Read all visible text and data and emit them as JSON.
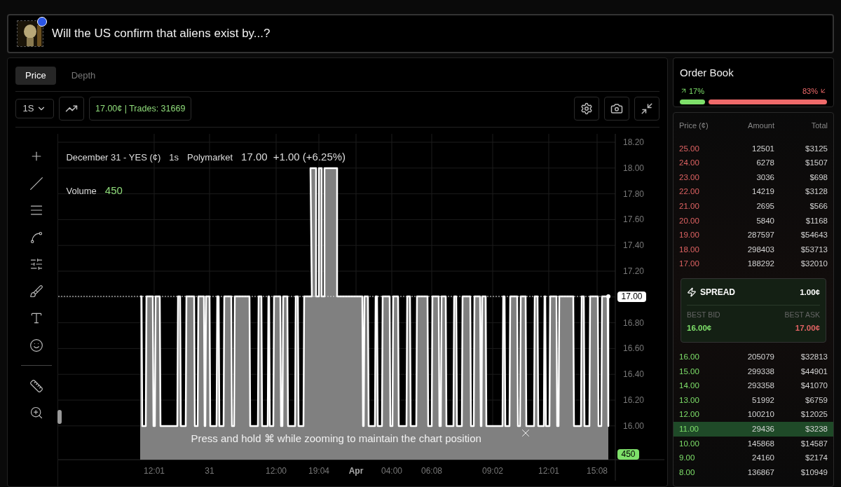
{
  "market": {
    "title": "Will the US confirm that aliens exist by...?"
  },
  "chart_panel": {
    "tabs": [
      {
        "label": "Price",
        "selected": true
      },
      {
        "label": "Depth",
        "selected": false
      }
    ],
    "interval": "1S",
    "ticker": "17.00¢ | Trades: 31669",
    "legend": {
      "series": "December 31 - YES (¢)",
      "interval": "1s",
      "source": "Polymarket",
      "price": "17.00",
      "change": "+1.00 (+6.25%)",
      "volume_label": "Volume",
      "volume": "450"
    },
    "y_ticks": [
      "18.20",
      "18.00",
      "17.80",
      "17.60",
      "17.40",
      "17.20",
      "16.80",
      "16.60",
      "16.40",
      "16.20",
      "16.00"
    ],
    "x_ticks": [
      {
        "label": "12:01",
        "bold": false
      },
      {
        "label": "31",
        "bold": false
      },
      {
        "label": "12:00",
        "bold": false
      },
      {
        "label": "19:04",
        "bold": false
      },
      {
        "label": "Apr",
        "bold": true
      },
      {
        "label": "04:00",
        "bold": false
      },
      {
        "label": "06:08",
        "bold": false
      },
      {
        "label": "09:02",
        "bold": false
      },
      {
        "label": "12:01",
        "bold": false
      },
      {
        "label": "15:08",
        "bold": false
      }
    ],
    "price_badge": "17.00",
    "volume_badge": "450",
    "hint": "Press and hold ⌘ while zooming to maintain the chart position"
  },
  "order_book": {
    "title": "Order Book",
    "buy_share": "17%",
    "sell_share": "83%",
    "level": 0.17,
    "columns": [
      "Price (¢)",
      "Amount",
      "Total"
    ],
    "asks": [
      {
        "price": "25.00",
        "amount": "12501",
        "total": "$3125",
        "selected": false
      },
      {
        "price": "24.00",
        "amount": "6278",
        "total": "$1507",
        "selected": false
      },
      {
        "price": "23.00",
        "amount": "3036",
        "total": "$698",
        "selected": false
      },
      {
        "price": "22.00",
        "amount": "14219",
        "total": "$3128",
        "selected": false
      },
      {
        "price": "21.00",
        "amount": "2695",
        "total": "$566",
        "selected": false
      },
      {
        "price": "20.00",
        "amount": "5840",
        "total": "$1168",
        "selected": false
      },
      {
        "price": "19.00",
        "amount": "287597",
        "total": "$54643",
        "selected": false
      },
      {
        "price": "18.00",
        "amount": "298403",
        "total": "$53713",
        "selected": false
      },
      {
        "price": "17.00",
        "amount": "188292",
        "total": "$32010",
        "selected": false
      }
    ],
    "spread": {
      "label": "SPREAD",
      "value": "1.00¢",
      "bid_label": "BEST BID",
      "bid": "16.00¢",
      "ask_label": "BEST ASK",
      "ask": "17.00¢"
    },
    "bids": [
      {
        "price": "16.00",
        "amount": "205079",
        "total": "$32813",
        "selected": false
      },
      {
        "price": "15.00",
        "amount": "299338",
        "total": "$44901",
        "selected": false
      },
      {
        "price": "14.00",
        "amount": "293358",
        "total": "$41070",
        "selected": false
      },
      {
        "price": "13.00",
        "amount": "51992",
        "total": "$6759",
        "selected": false
      },
      {
        "price": "12.00",
        "amount": "100210",
        "total": "$12025",
        "selected": false
      },
      {
        "price": "11.00",
        "amount": "29436",
        "total": "$3238",
        "selected": true
      },
      {
        "price": "10.00",
        "amount": "145868",
        "total": "$14587",
        "selected": false
      },
      {
        "price": "9.00",
        "amount": "24160",
        "total": "$2174",
        "selected": false
      },
      {
        "price": "8.00",
        "amount": "136867",
        "total": "$10949",
        "selected": false
      }
    ]
  }
}
